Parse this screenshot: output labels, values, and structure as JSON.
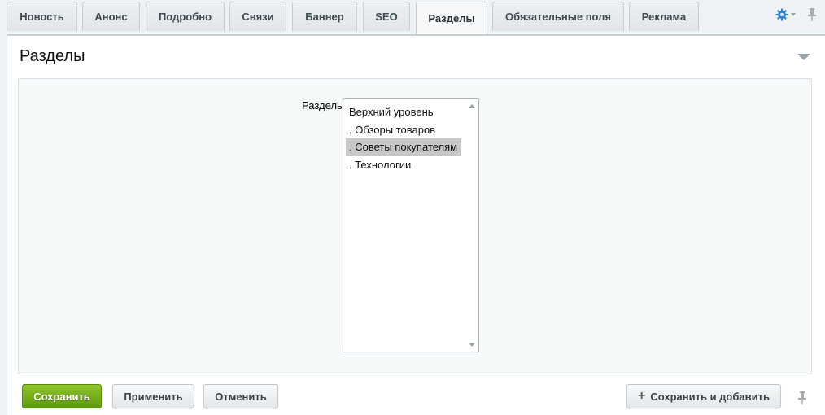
{
  "tabs": [
    {
      "label": "Новость",
      "active": false
    },
    {
      "label": "Анонс",
      "active": false
    },
    {
      "label": "Подробно",
      "active": false
    },
    {
      "label": "Связи",
      "active": false
    },
    {
      "label": "Баннер",
      "active": false
    },
    {
      "label": "SEO",
      "active": false
    },
    {
      "label": "Разделы",
      "active": true
    },
    {
      "label": "Обязательные поля",
      "active": false
    },
    {
      "label": "Реклама",
      "active": false
    }
  ],
  "panel": {
    "title": "Разделы",
    "field_label": "Разделы:",
    "sections_list": [
      {
        "label": "Верхний уровень",
        "selected": false
      },
      {
        "label": ". Обзоры товаров",
        "selected": false
      },
      {
        "label": ". Советы покупателям",
        "selected": true
      },
      {
        "label": ". Технологии",
        "selected": false
      }
    ]
  },
  "footer": {
    "save_label": "Сохранить",
    "apply_label": "Применить",
    "cancel_label": "Отменить",
    "save_add_label": "Сохранить и добавить"
  },
  "colors": {
    "save_button": "#6aa816",
    "selected_item": "#c8c8c8",
    "gear": "#2b83d1"
  },
  "icons": {
    "gear": "gear-icon",
    "pin": "pin-icon",
    "collapse": "chevron-down-icon",
    "plus": "plus-icon"
  }
}
